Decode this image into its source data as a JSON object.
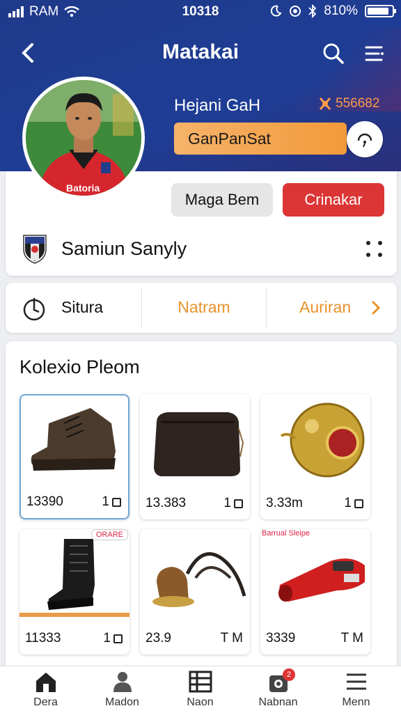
{
  "status_bar": {
    "carrier": "RAM",
    "time": "10318",
    "battery": "810%"
  },
  "nav": {
    "title": "Matakai"
  },
  "profile": {
    "name": "Hejani GaH",
    "count": "556682",
    "rank": "GanPanSat",
    "follow_label": "Maga Bem",
    "action_label": "Crinakar"
  },
  "club": {
    "name": "Samiun Sanyly"
  },
  "tabs": [
    {
      "label": "Situra"
    },
    {
      "label": "Natram"
    },
    {
      "label": "Auriran"
    }
  ],
  "collection": {
    "title": "Kolexio Pleom",
    "items": [
      {
        "price": "13390",
        "qty": "1",
        "image": "leather-boot"
      },
      {
        "price": "13.383",
        "qty": "1",
        "image": "leather-bag"
      },
      {
        "price": "3.33m",
        "qty": "1",
        "image": "gold-ball"
      },
      {
        "price": "11333",
        "qty": "1",
        "image": "black-boot",
        "badge": "ORARE"
      },
      {
        "price": "23.9",
        "qty": "T M",
        "image": "bronze-bowl",
        "caption": "Barrual Sleipe"
      },
      {
        "price": "3339",
        "qty": "T M",
        "image": "red-whistle"
      }
    ]
  },
  "bottom_nav": [
    {
      "label": "Dera",
      "icon": "home-icon"
    },
    {
      "label": "Madon",
      "icon": "user-icon"
    },
    {
      "label": "Naon",
      "icon": "grid-icon"
    },
    {
      "label": "Nabnan",
      "icon": "bag-icon",
      "badge": "2"
    },
    {
      "label": "Menn",
      "icon": "menu-icon"
    }
  ],
  "colors": {
    "header": "#1f3a8a",
    "accent": "#e8922a",
    "danger": "#dc3535"
  }
}
